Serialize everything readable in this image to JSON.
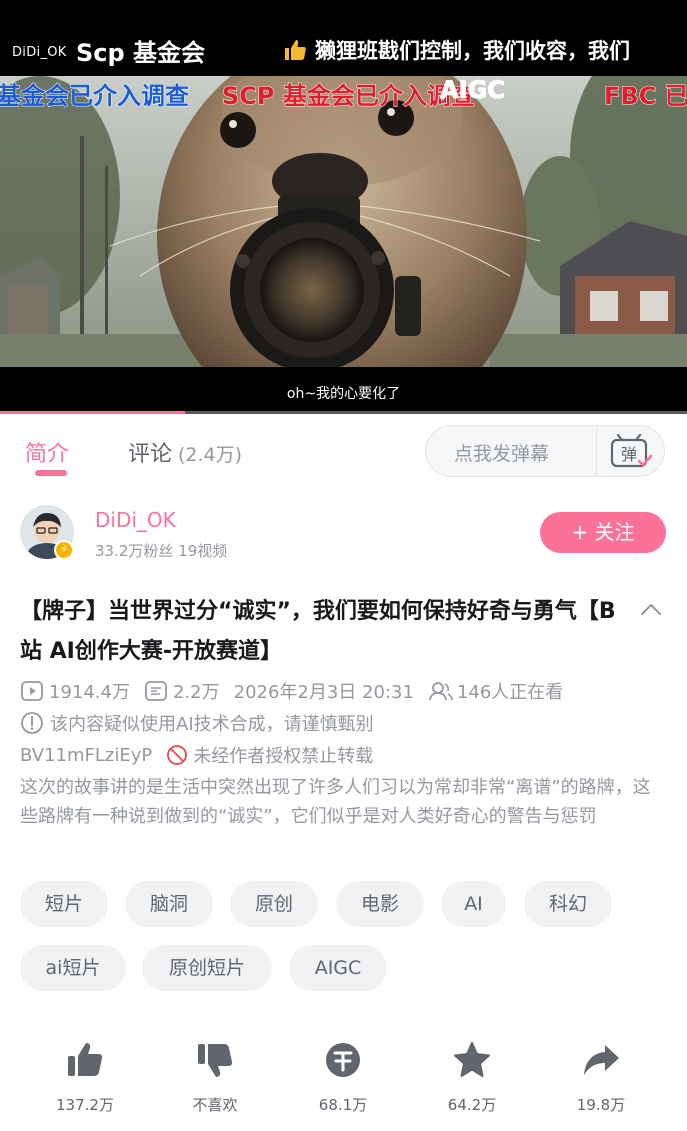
{
  "video": {
    "watermark": "DiDi_OK",
    "channel": "Scp 基金会",
    "top_danmaku": "獭狸班戡们控制，我们收容，我们",
    "danmaku": [
      {
        "text": "基金会已介入调查",
        "color": "#1a5bd6"
      },
      {
        "text": "SCP 基金会已介入调查",
        "color": "#e01d2a"
      },
      {
        "text": "AIGC",
        "color": "#ffffff"
      },
      {
        "text": "FBC 已",
        "color": "#e01d2a"
      }
    ],
    "subtitle": "oh~我的心要化了",
    "progress": 0.27
  },
  "tabs": {
    "intro": "简介",
    "comments": "评论",
    "comments_count": "(2.4万)",
    "danmaku_placeholder": "点我发弹幕",
    "danmaku_toggle": "弹"
  },
  "uploader": {
    "name": "DiDi_OK",
    "stats": "33.2万粉丝  19视频",
    "follow": "+ 关注"
  },
  "video_info": {
    "title": "【牌子】当世界过分“诚实”，我们要如何保持好奇与勇气【B站 AI创作大赛-开放赛道】",
    "views": "1914.4万",
    "danmaku_count": "2.2万",
    "date": "2026年2月3日 20:31",
    "watching": "146人正在看",
    "ai_notice": "该内容疑似使用AI技术合成，请谨慎甄别",
    "bvid": "BV11mFLziEyP",
    "copyright": "未经作者授权禁止转载",
    "description": "这次的故事讲的是生活中突然出现了许多人们习以为常却非常“离谱”的路牌，这些路牌有一种说到做到的“诚实”，它们似乎是对人类好奇心的警告与惩罚"
  },
  "tags": [
    "短片",
    "脑洞",
    "原创",
    "电影",
    "AI",
    "科幻",
    "ai短片",
    "原创短片",
    "AIGC"
  ],
  "actions": {
    "like": "137.2万",
    "dislike": "不喜欢",
    "coin": "68.1万",
    "favorite": "64.2万",
    "share": "19.8万"
  },
  "colors": {
    "accent": "#fb7299",
    "muted": "#9499a0"
  }
}
